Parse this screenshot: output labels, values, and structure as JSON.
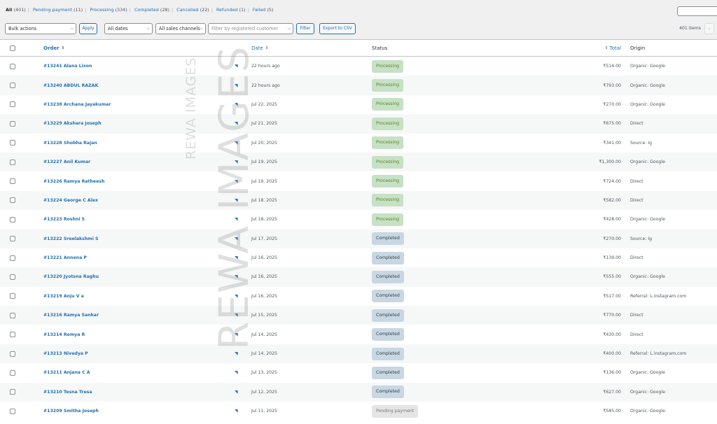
{
  "filters": {
    "all": "All",
    "all_count": "(401)",
    "pending": "Pending payment",
    "pending_count": "(11)",
    "processing": "Processing",
    "processing_count": "(334)",
    "completed": "Completed",
    "completed_count": "(28)",
    "cancelled": "Cancelled",
    "cancelled_count": "(22)",
    "refunded": "Refunded",
    "refunded_count": "(1)",
    "failed": "Failed",
    "failed_count": "(5)"
  },
  "toolbar": {
    "bulk_actions": "Bulk actions",
    "apply": "Apply",
    "dates": "All dates",
    "channels": "All sales channels",
    "customer_placeholder": "Filter by registered customer",
    "filter": "Filter",
    "export": "Export to CSV",
    "items_count": "401 items",
    "prev_page": "‹"
  },
  "columns": {
    "order": "Order",
    "date": "Date",
    "status": "Status",
    "total": "Total",
    "origin": "Origin"
  },
  "watermark": "REWA IMAGES",
  "orders": [
    {
      "order": "#13241 Alana Lixon",
      "date": "22 hours ago",
      "status": "Processing",
      "status_key": "processing",
      "total": "₹514.00",
      "origin": "Organic: Google"
    },
    {
      "order": "#13240 ABDUL RAZAK",
      "date": "22 hours ago",
      "status": "Processing",
      "status_key": "processing",
      "total": "₹793.00",
      "origin": "Organic: Google"
    },
    {
      "order": "#13238 Archana Jayakumar",
      "date": "Jul 22, 2025",
      "status": "Processing",
      "status_key": "processing",
      "total": "₹270.00",
      "origin": "Organic: Google"
    },
    {
      "order": "#13229 Akshara Joseph",
      "date": "Jul 21, 2025",
      "status": "Processing",
      "status_key": "processing",
      "total": "₹675.00",
      "origin": "Direct"
    },
    {
      "order": "#13228 Shobha Rajan",
      "date": "Jul 20, 2025",
      "status": "Processing",
      "status_key": "processing",
      "total": "₹341.00",
      "origin": "Source: Ig"
    },
    {
      "order": "#13227 Anil Kumar",
      "date": "Jul 19, 2025",
      "status": "Processing",
      "status_key": "processing",
      "total": "₹1,300.00",
      "origin": "Organic: Google"
    },
    {
      "order": "#13226 Ramya Ratheesh",
      "date": "Jul 19, 2025",
      "status": "Processing",
      "status_key": "processing",
      "total": "₹724.00",
      "origin": "Direct"
    },
    {
      "order": "#13224 George C Alex",
      "date": "Jul 18, 2025",
      "status": "Processing",
      "status_key": "processing",
      "total": "₹582.00",
      "origin": "Direct"
    },
    {
      "order": "#13223 Roshni S",
      "date": "Jul 18, 2025",
      "status": "Processing",
      "status_key": "processing",
      "total": "₹428.00",
      "origin": "Organic: Google"
    },
    {
      "order": "#13222 Sreelakshmi S",
      "date": "Jul 17, 2025",
      "status": "Completed",
      "status_key": "completed",
      "total": "₹270.00",
      "origin": "Source: Ig"
    },
    {
      "order": "#13221 Annena P",
      "date": "Jul 16, 2025",
      "status": "Completed",
      "status_key": "completed",
      "total": "₹139.00",
      "origin": "Direct"
    },
    {
      "order": "#13220 Jyotsna Raghu",
      "date": "Jul 16, 2025",
      "status": "Completed",
      "status_key": "completed",
      "total": "₹555.00",
      "origin": "Organic: Google"
    },
    {
      "order": "#13219 Anju V a",
      "date": "Jul 16, 2025",
      "status": "Completed",
      "status_key": "completed",
      "total": "₹517.00",
      "origin": "Referral: L.instagram.com"
    },
    {
      "order": "#13216 Ramya Sankar",
      "date": "Jul 15, 2025",
      "status": "Completed",
      "status_key": "completed",
      "total": "₹770.00",
      "origin": "Direct"
    },
    {
      "order": "#13214 Remya R",
      "date": "Jul 14, 2025",
      "status": "Completed",
      "status_key": "completed",
      "total": "₹430.00",
      "origin": "Direct"
    },
    {
      "order": "#13213 Nivedya P",
      "date": "Jul 14, 2025",
      "status": "Completed",
      "status_key": "completed",
      "total": "₹400.00",
      "origin": "Referral: L.instagram.com"
    },
    {
      "order": "#13211 Anjana C A",
      "date": "Jul 13, 2025",
      "status": "Completed",
      "status_key": "completed",
      "total": "₹136.00",
      "origin": "Organic: Google"
    },
    {
      "order": "#13210 Tesna Tresa",
      "date": "Jul 12, 2025",
      "status": "Completed",
      "status_key": "completed",
      "total": "₹627.00",
      "origin": "Organic: Google"
    },
    {
      "order": "#13209 Smitha Joseph",
      "date": "Jul 11, 2025",
      "status": "Pending payment",
      "status_key": "pending",
      "total": "₹585.00",
      "origin": "Organic: Google"
    }
  ]
}
